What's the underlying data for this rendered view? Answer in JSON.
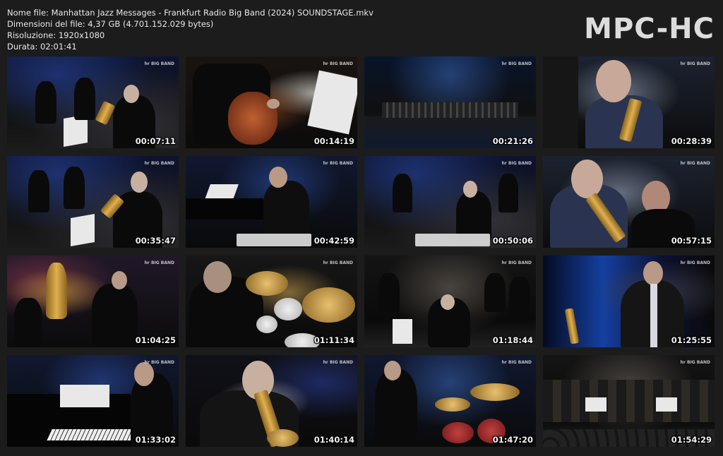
{
  "info": {
    "filename": "Nome file: Manhattan Jazz Messages - Frankfurt Radio Big Band (2024) SOUNDSTAGE.mkv",
    "filesize": "Dimensioni del file: 4,37 GB (4.701.152.029 bytes)",
    "resolution": "Risoluzione: 1920x1080",
    "duration": "Durata: 02:01:41"
  },
  "logo": "MPC-HC",
  "watermark": "hr BIG BAND",
  "thumbnails": [
    {
      "time": "00:07:11",
      "scene": "band-sax-front"
    },
    {
      "time": "00:14:19",
      "scene": "guitar-closeup"
    },
    {
      "time": "00:21:26",
      "scene": "wide-stage"
    },
    {
      "time": "00:28:39",
      "scene": "sax-portrait"
    },
    {
      "time": "00:35:47",
      "scene": "band-sax-front"
    },
    {
      "time": "00:42:59",
      "scene": "pianist-caption"
    },
    {
      "time": "00:50:06",
      "scene": "band-caption"
    },
    {
      "time": "00:57:15",
      "scene": "sax-portrait"
    },
    {
      "time": "01:04:25",
      "scene": "trumpet-section"
    },
    {
      "time": "01:11:34",
      "scene": "drummer"
    },
    {
      "time": "01:18:44",
      "scene": "band-wide"
    },
    {
      "time": "01:25:55",
      "scene": "soloist-blue"
    },
    {
      "time": "01:33:02",
      "scene": "pianist"
    },
    {
      "time": "01:40:14",
      "scene": "trumpet-closeup"
    },
    {
      "time": "01:47:20",
      "scene": "drums-stage"
    },
    {
      "time": "01:54:29",
      "scene": "band-full"
    }
  ]
}
